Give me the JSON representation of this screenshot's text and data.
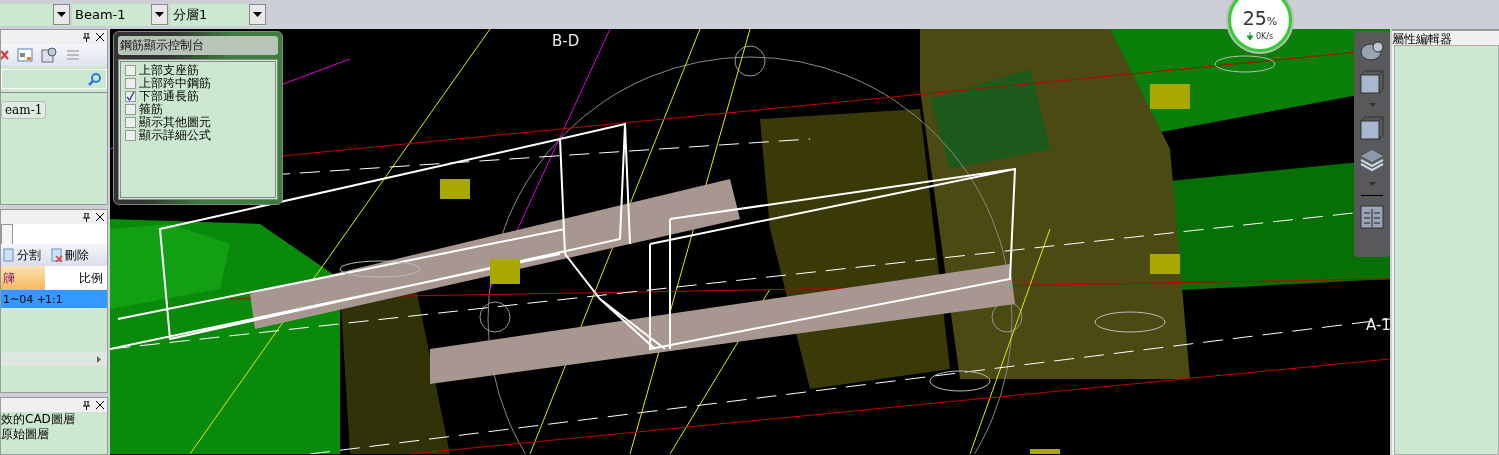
{
  "top_bar": {
    "combos": [
      {
        "value": "Beam-1"
      },
      {
        "value": "分層1"
      }
    ]
  },
  "network_widget": {
    "percent": "25",
    "unit": "%",
    "speed": "0K/s"
  },
  "left_panels": {
    "tree": {
      "items": [
        "eam-1"
      ]
    },
    "segments": {
      "buttons": [
        "分割",
        "刪除"
      ],
      "columns": [
        {
          "label": "簰",
          "sorted": true
        },
        {
          "label": "比例",
          "sorted": false
        }
      ],
      "rows": [
        {
          "cells": [
            "1~04 +",
            "1:1"
          ],
          "selected": true
        }
      ]
    },
    "layers": {
      "items": [
        "效的CAD圖層",
        "原始圖層"
      ]
    }
  },
  "rebar_console": {
    "title": "鋼筋顯示控制台",
    "options": [
      {
        "label": "上部支座筋",
        "checked": false
      },
      {
        "label": "上部跨中鋼筋",
        "checked": false
      },
      {
        "label": "下部通長筋",
        "checked": true
      },
      {
        "label": "箍筋",
        "checked": false
      },
      {
        "label": "顯示其他圖元",
        "checked": false
      },
      {
        "label": "顯示詳細公式",
        "checked": false
      }
    ]
  },
  "viewport": {
    "axis_labels": [
      {
        "text": "B-D"
      },
      {
        "text": "A-1"
      }
    ]
  },
  "property_editor": {
    "title": "屬性編輯器"
  }
}
